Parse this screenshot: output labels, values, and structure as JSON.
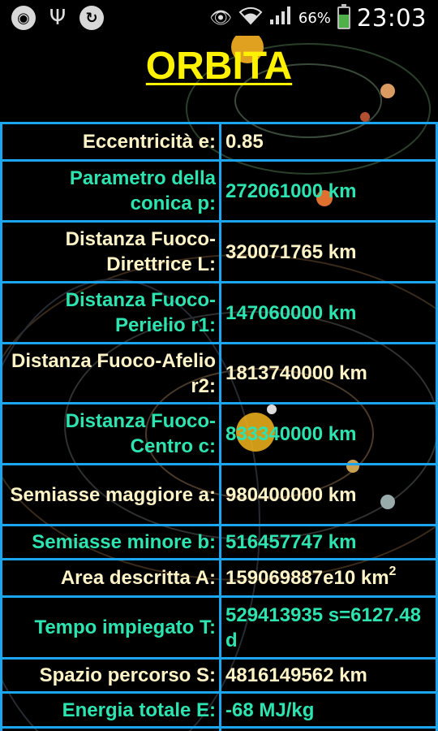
{
  "status_bar": {
    "left_icons": [
      "circle-app-icon",
      "usb-icon",
      "sync-icon"
    ],
    "right_icons": [
      "eye-icon",
      "wifi-icon",
      "signal-icon",
      "battery-icon"
    ],
    "battery_percent": "66%",
    "battery_level": 0.66,
    "time": "23:03"
  },
  "title": "ORBITA",
  "rows": [
    {
      "label": "Eccentricità e:",
      "value": "0.85",
      "color": "#fdf3c6"
    },
    {
      "label": "Parametro della conica p:",
      "value": "272061000 km",
      "color": "#2de3b0"
    },
    {
      "label": "Distanza Fuoco-Direttrice L:",
      "value": "320071765 km",
      "color": "#fdf3c6"
    },
    {
      "label": "Distanza Fuoco-Perielio r1:",
      "value": "147060000 km",
      "color": "#2de3b0"
    },
    {
      "label": "Distanza Fuoco-Afelio r2:",
      "value": "1813740000 km",
      "color": "#fdf3c6"
    },
    {
      "label": "Distanza Fuoco-Centro c:",
      "value": "833340000 km",
      "color": "#2de3b0"
    },
    {
      "label": "Semiasse maggiore a:",
      "value": "980400000 km",
      "color": "#fdf3c6"
    },
    {
      "label": "Semiasse minore b:",
      "value": "516457747 km",
      "color": "#2de3b0"
    },
    {
      "label": "Area descritta A:",
      "value": "159069887e10 km",
      "sup": "2",
      "color": "#fdf3c6"
    },
    {
      "label": "Tempo impiegato T:",
      "value": "529413935 s=6127.48 d",
      "color": "#2de3b0"
    },
    {
      "label": "Spazio percorso S:",
      "value": "4816149562 km",
      "color": "#fdf3c6"
    },
    {
      "label": "Energia totale E:",
      "value": "-68 MJ/kg",
      "color": "#2de3b0"
    }
  ]
}
